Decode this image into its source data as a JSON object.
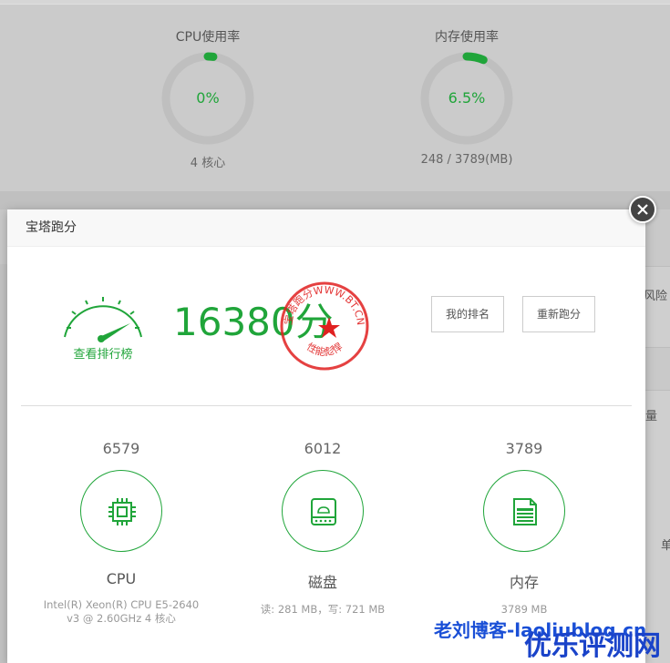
{
  "background": {
    "cpu_gauge": {
      "title": "CPU使用率",
      "value": "0%",
      "sub": "4 核心",
      "percent": 0.02
    },
    "mem_gauge": {
      "title": "内存使用率",
      "value": "6.5%",
      "sub": "248 / 3789(MB)",
      "percent": 0.065
    },
    "edge_text_1": "风险",
    "edge_text_2": "量",
    "edge_text_3": "单"
  },
  "dialog": {
    "title": "宝塔跑分",
    "speedometer_label": "查看排行榜",
    "total_score": "16380分",
    "seal": {
      "top_text": "宝塔跑分WWW.BT.CN",
      "bottom_text": "性能彪悍"
    },
    "buttons": {
      "my_rank": "我的排名",
      "rerun": "重新跑分"
    },
    "metrics": [
      {
        "score": "6579",
        "name": "CPU",
        "detail": "Intel(R) Xeon(R) CPU E5-2640 v3 @ 2.60GHz 4 核心",
        "icon": "cpu-chip-icon"
      },
      {
        "score": "6012",
        "name": "磁盘",
        "detail": "读: 281 MB，写: 721 MB",
        "icon": "disk-drive-icon"
      },
      {
        "score": "3789",
        "name": "内存",
        "detail": "3789 MB",
        "icon": "memory-document-icon"
      }
    ]
  },
  "watermarks": {
    "blog": "老刘博客-laoliublog.cn",
    "brand": "优乐评测网"
  },
  "colors": {
    "accent": "#20a53a",
    "seal": "#e02020",
    "watermark": "#1a43c9"
  }
}
